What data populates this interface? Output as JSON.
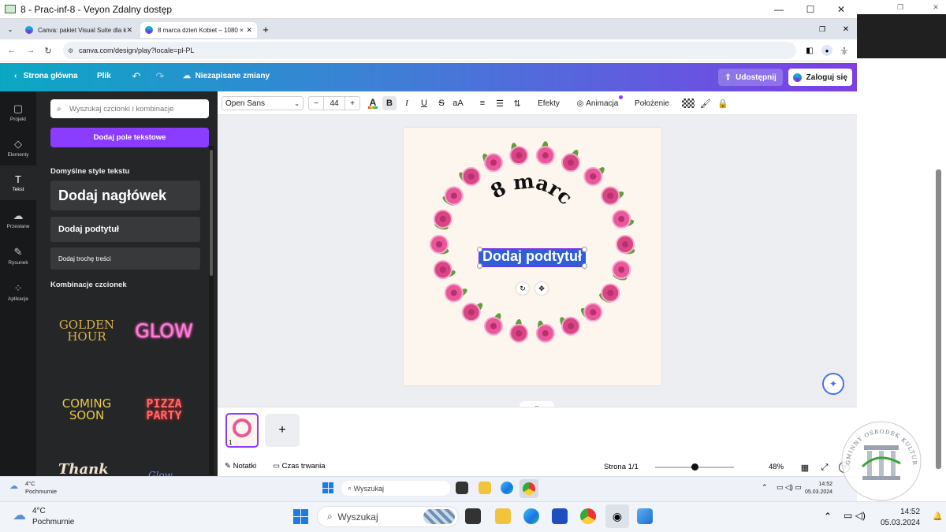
{
  "window": {
    "title": "8 - Prac-inf-8 - Veyon Zdalny dostęp"
  },
  "browser": {
    "tabs": [
      {
        "label": "Canva: pakiet Visual Suite dla k",
        "active": false
      },
      {
        "label": "8 marca dzień Kobiet – 1080 ×",
        "active": true
      }
    ],
    "url": "canva.com/design/play?locale=pl-PL"
  },
  "header": {
    "home": "Strona główna",
    "file": "Plik",
    "unsaved": "Niezapisane zmiany",
    "share": "Udostępnij",
    "login": "Zaloguj się"
  },
  "rail": [
    {
      "label": "Projekt",
      "glyph": "▢"
    },
    {
      "label": "Elementy",
      "glyph": "◇"
    },
    {
      "label": "Tekst",
      "glyph": "T"
    },
    {
      "label": "Przesłane",
      "glyph": "☁"
    },
    {
      "label": "Rysunek",
      "glyph": "✎"
    },
    {
      "label": "Aplikacje",
      "glyph": "⁘"
    }
  ],
  "panel": {
    "search_placeholder": "Wyszukaj czcionki i kombinacje",
    "add_textbox": "Dodaj pole tekstowe",
    "default_styles": "Domyślne style tekstu",
    "heading": "Dodaj nagłówek",
    "subheading": "Dodaj podtytuł",
    "body": "Dodaj trochę treści",
    "combos_title": "Kombinacje czcionek",
    "combos": [
      "GOLDEN\nHOUR",
      "GLOW",
      "COMING\nSOON",
      "PIZZA\nPARTY",
      "Thank",
      "Glow"
    ]
  },
  "toolbar": {
    "font": "Open Sans",
    "size": "44",
    "minus": "−",
    "plus": "+",
    "effects": "Efekty",
    "animation": "Animacja",
    "position": "Położenie"
  },
  "design": {
    "title_text": "8 marca",
    "selected_text": "Dodaj podtytuł"
  },
  "pages": {
    "current_number": "1",
    "add": "+"
  },
  "status": {
    "notes": "Notatki",
    "duration": "Czas trwania",
    "page": "Strona 1/1",
    "zoom": "48%",
    "zoom_fraction": 0.5
  },
  "remote_taskbar": {
    "temp": "4°C",
    "weather": "Pochmurnie",
    "search": "Wyszukaj",
    "time": "14:52",
    "date": "05.03.2024"
  },
  "host_taskbar": {
    "temp": "4°C",
    "weather": "Pochmurnie",
    "search": "Wyszukaj",
    "time": "14:52",
    "date": "05.03.2024"
  },
  "watermark": {
    "text": "GMINNY OŚRODEK KULTURY W STAWISZYNIE"
  },
  "colors": {
    "canva_purple": "#8b3dff",
    "selection": "#2e5fd6",
    "teal": "#0ba8c4"
  }
}
